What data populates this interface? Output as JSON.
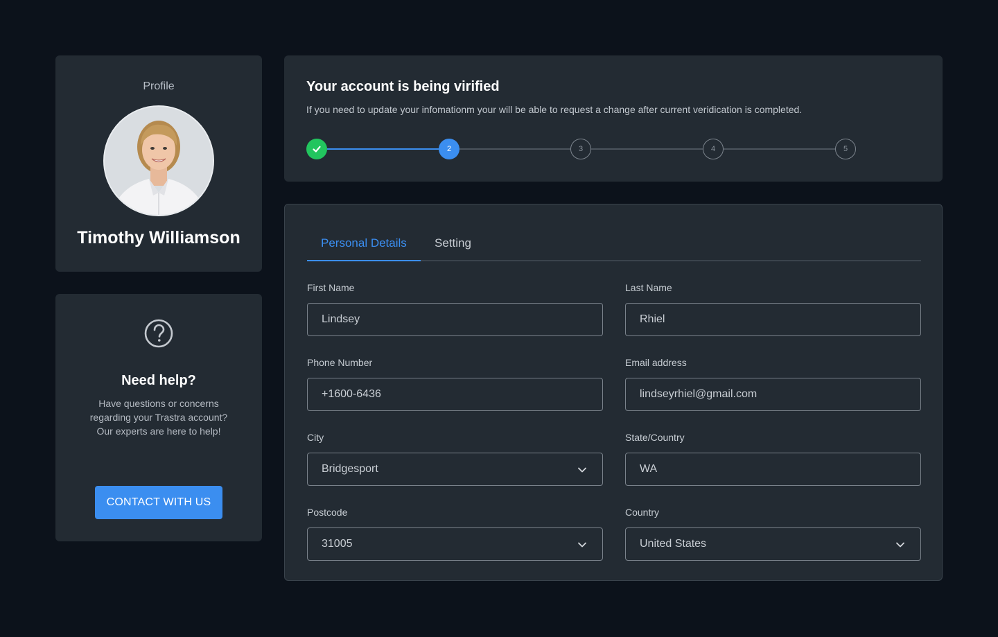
{
  "profile": {
    "title": "Profile",
    "name": "Timothy Williamson"
  },
  "help": {
    "title": "Need help?",
    "lines": [
      "Have questions or concerns",
      "regarding your Trastra account?",
      "Our experts are here to help!"
    ],
    "button_label": "CONTACT WITH US",
    "icon": "question-circle-icon"
  },
  "verification": {
    "title": "Your account is being virified",
    "description": "If you need to update your infomationm your will be able to request a change after current veridication is completed.",
    "steps": [
      {
        "label": "",
        "state": "complete"
      },
      {
        "label": "2",
        "state": "active"
      },
      {
        "label": "3",
        "state": "pending"
      },
      {
        "label": "4",
        "state": "pending"
      },
      {
        "label": "5",
        "state": "pending"
      }
    ]
  },
  "tabs": [
    {
      "label": "Personal Details",
      "active": true
    },
    {
      "label": "Setting",
      "active": false
    }
  ],
  "form": {
    "first_name": {
      "label": "First Name",
      "value": "Lindsey"
    },
    "last_name": {
      "label": "Last Name",
      "value": "Rhiel"
    },
    "phone": {
      "label": "Phone Number",
      "value": "+1600-6436"
    },
    "email": {
      "label": "Email address",
      "value": "lindseyrhiel@gmail.com"
    },
    "city": {
      "label": "City",
      "value": "Bridgesport"
    },
    "state": {
      "label": "State/Country",
      "value": "WA"
    },
    "postcode": {
      "label": "Postcode",
      "value": "31005"
    },
    "country": {
      "label": "Country",
      "value": "United States"
    }
  },
  "colors": {
    "accent": "#3b8ef0",
    "success": "#22c55e",
    "background": "#0c121b",
    "card": "#232b33"
  }
}
